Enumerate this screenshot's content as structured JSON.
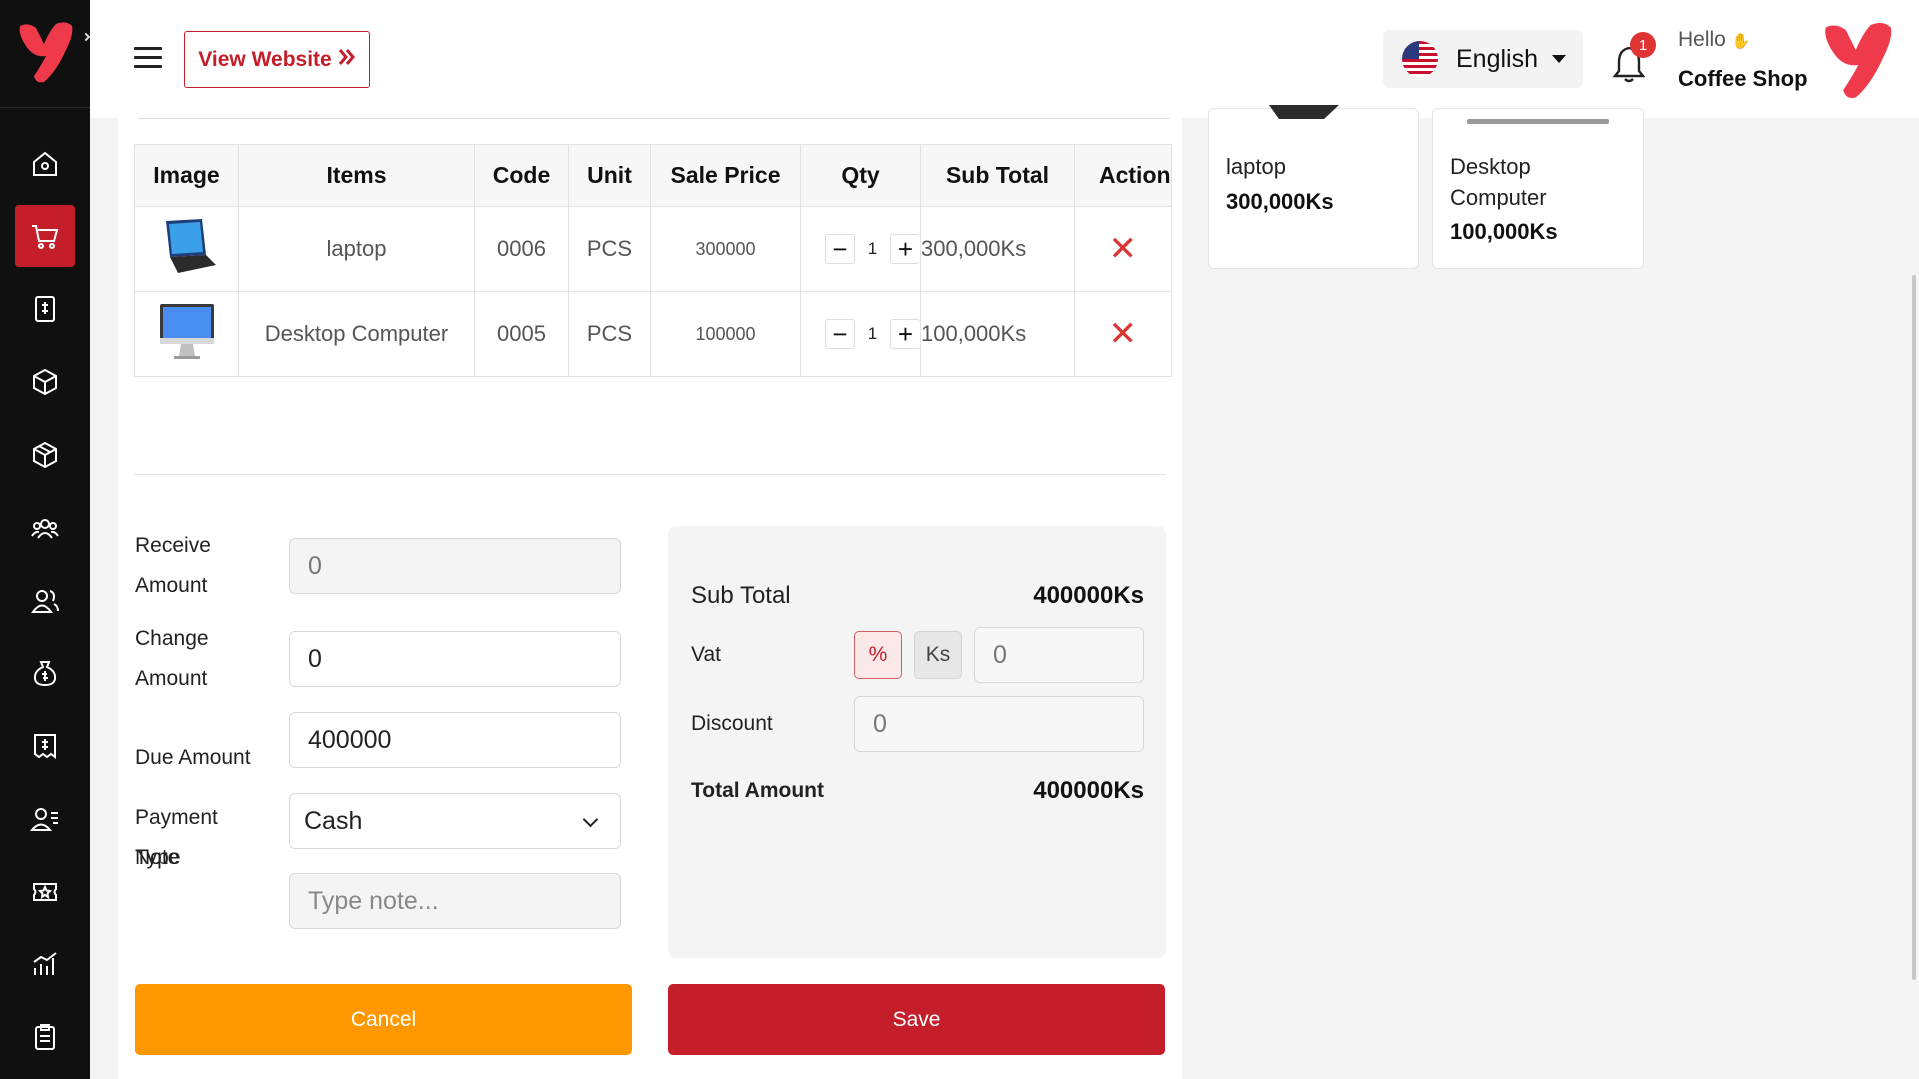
{
  "header": {
    "view_website_label": "View Website",
    "language": "English",
    "notification_count": "1",
    "greeting": "Hello",
    "shop_name": "Coffee Shop"
  },
  "sidebar": {
    "items": [
      {
        "icon": "home-icon"
      },
      {
        "icon": "cart-icon",
        "active": true
      },
      {
        "icon": "receipt-icon"
      },
      {
        "icon": "box-icon"
      },
      {
        "icon": "package-icon"
      },
      {
        "icon": "users-group-icon"
      },
      {
        "icon": "users-icon"
      },
      {
        "icon": "money-bag-icon"
      },
      {
        "icon": "invoice-icon"
      },
      {
        "icon": "user-list-icon"
      },
      {
        "icon": "ticket-icon"
      },
      {
        "icon": "chart-icon"
      },
      {
        "icon": "clipboard-icon"
      }
    ]
  },
  "table": {
    "headers": [
      "Image",
      "Items",
      "Code",
      "Unit",
      "Sale Price",
      "Qty",
      "Sub Total",
      "Action"
    ],
    "rows": [
      {
        "item": "laptop",
        "code": "0006",
        "unit": "PCS",
        "sale_price": "300000",
        "qty": "1",
        "sub_total": "300,000Ks",
        "image_icon": "laptop-image"
      },
      {
        "item": "Desktop Computer",
        "code": "0005",
        "unit": "PCS",
        "sale_price": "100000",
        "qty": "1",
        "sub_total": "100,000Ks",
        "image_icon": "desktop-image"
      }
    ]
  },
  "form": {
    "receive_label_1": "Receive",
    "receive_label_2": "Amount",
    "receive_value": "0",
    "change_label_1": "Change",
    "change_label_2": "Amount",
    "change_value": "0",
    "due_label": "Due Amount",
    "due_value": "400000",
    "payment_label_1": "Payment",
    "payment_label_2": "Type",
    "payment_value": "Cash",
    "note_label": "Note",
    "note_placeholder": "Type note..."
  },
  "summary": {
    "sub_total_label": "Sub Total",
    "sub_total_value": "400000Ks",
    "vat_label": "Vat",
    "vat_percent": "%",
    "vat_ks": "Ks",
    "vat_value": "0",
    "discount_label": "Discount",
    "discount_value": "0",
    "total_label": "Total Amount",
    "total_value": "400000Ks"
  },
  "actions": {
    "cancel": "Cancel",
    "save": "Save"
  },
  "products": [
    {
      "name": "laptop",
      "price": "300,000Ks"
    },
    {
      "name_line1": "Desktop",
      "name_line2": "Computer",
      "price": "100,000Ks"
    }
  ],
  "colors": {
    "sidebar": "#101010",
    "accent": "#c41e2a",
    "cancel": "#ff9800",
    "delete": "#d93636"
  }
}
